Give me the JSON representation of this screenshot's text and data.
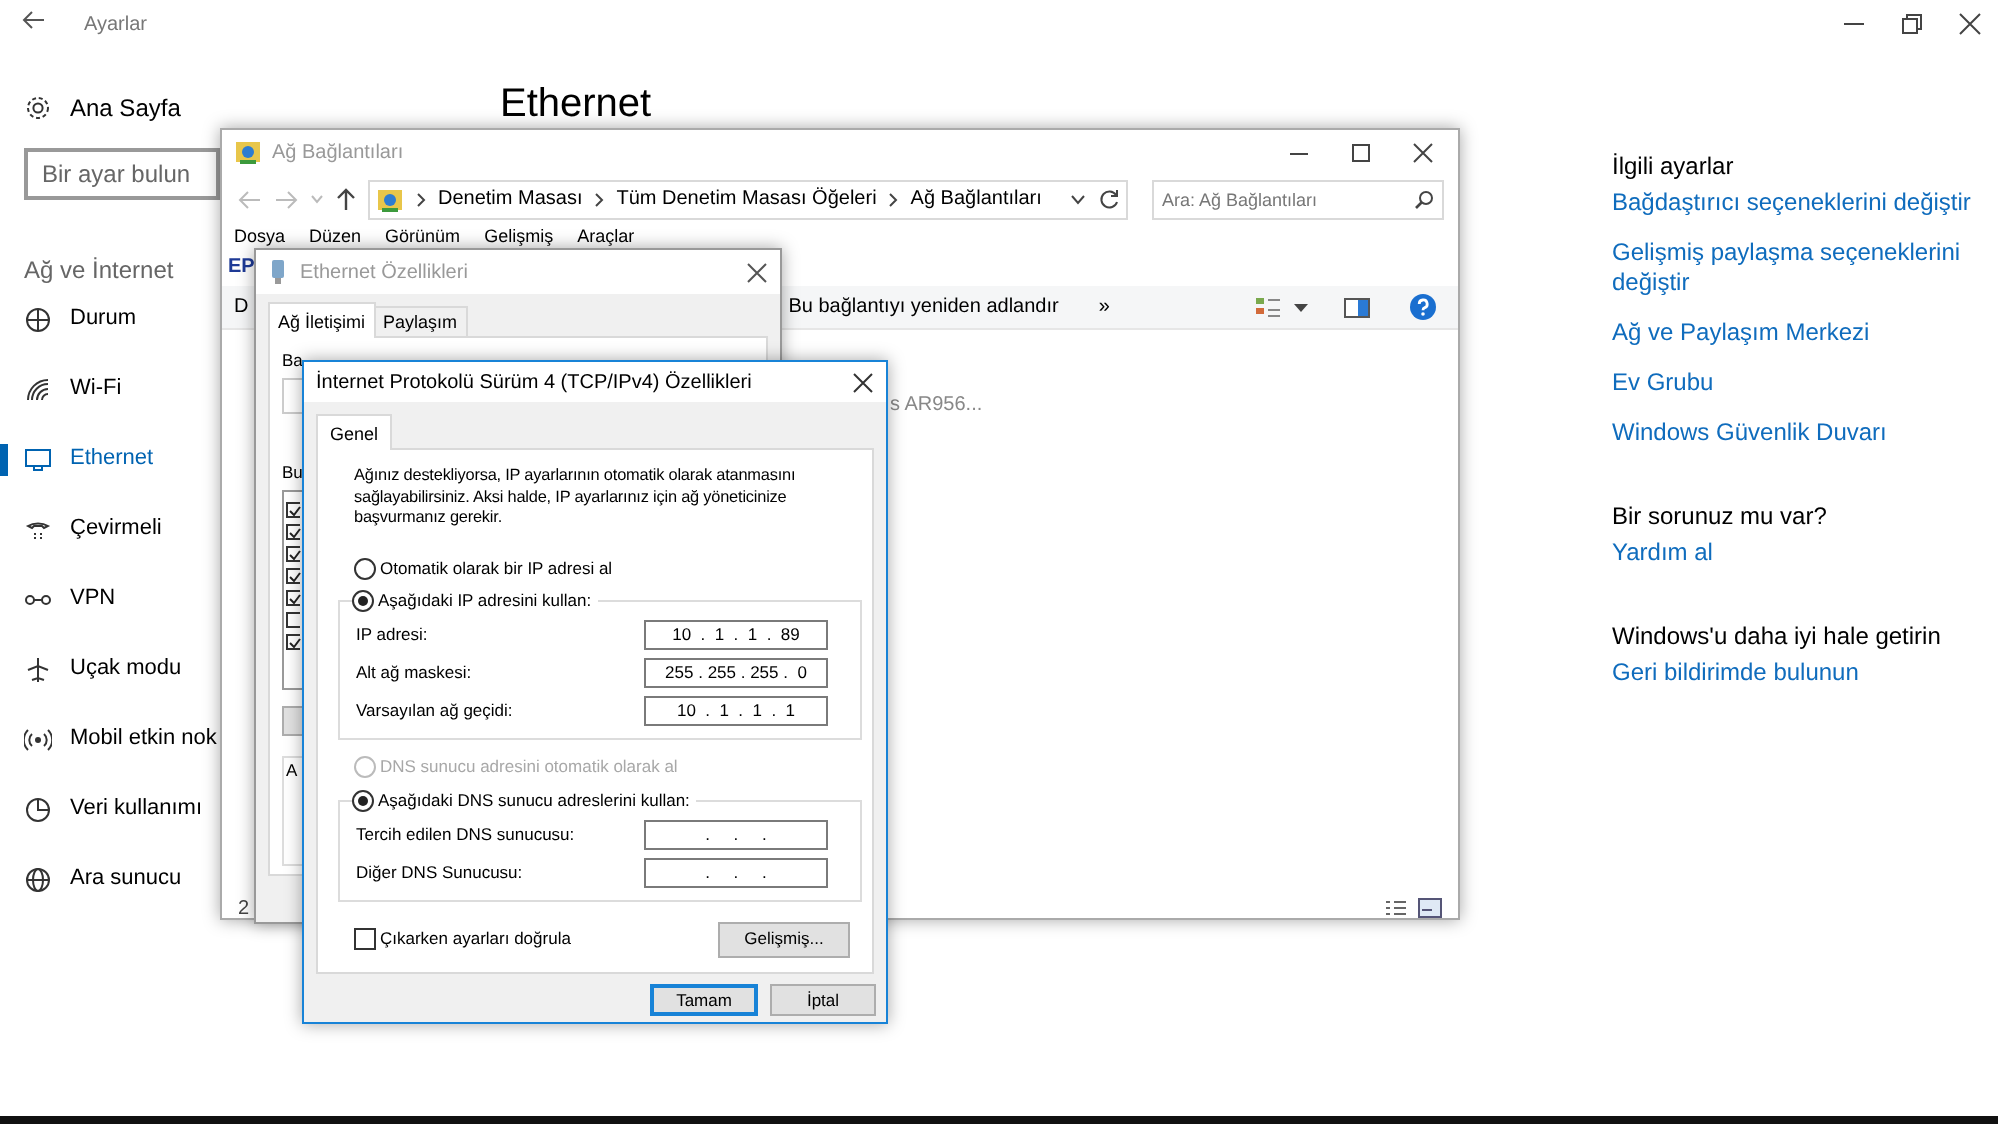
{
  "settings": {
    "title": "Ayarlar",
    "home": "Ana Sayfa",
    "search": {
      "placeholder": "Bir ayar bulun"
    },
    "section": "Ağ ve İnternet",
    "nav": [
      {
        "label": "Durum",
        "selected": false
      },
      {
        "label": "Wi-Fi",
        "selected": false
      },
      {
        "label": "Ethernet",
        "selected": true
      },
      {
        "label": "Çevirmeli",
        "selected": false
      },
      {
        "label": "VPN",
        "selected": false
      },
      {
        "label": "Uçak modu",
        "selected": false
      },
      {
        "label": "Mobil etkin nok",
        "selected": false
      },
      {
        "label": "Veri kullanımı",
        "selected": false
      },
      {
        "label": "Ara sunucu",
        "selected": false
      }
    ],
    "heading": "Ethernet",
    "related": {
      "title": "İlgili ayarlar",
      "links": [
        "Bağdaştırıcı seçeneklerini değiştir",
        "Gelişmiş paylaşma seçeneklerini değiştir",
        "Ağ ve Paylaşım Merkezi",
        "Ev Grubu",
        "Windows Güvenlik Duvarı"
      ]
    },
    "help": {
      "title": "Bir sorunuz mu var?",
      "link": "Yardım al"
    },
    "feedback": {
      "title": "Windows'u daha iyi hale getirin",
      "link": "Geri bildirimde bulunun"
    }
  },
  "explorer": {
    "title": "Ağ Bağlantıları",
    "breadcrumb": [
      "Denetim Masası",
      "Tüm Denetim Masası Öğeleri",
      "Ağ Bağlantıları"
    ],
    "search": {
      "placeholder": "Ara: Ağ Bağlantıları"
    },
    "menu": [
      "Dosya",
      "Düzen",
      "Görünüm",
      "Gelişmiş",
      "Araçlar"
    ],
    "heading_fragment": "EP",
    "command_fragment": "D",
    "command": "Bu bağlantıyı yeniden adlandır",
    "more": "»",
    "item_fragment": "s AR956...",
    "status_fragment": "2"
  },
  "ethernet_properties": {
    "title": "Ethernet Özellikleri",
    "tabs": [
      {
        "label": "Ağ İletişimi",
        "selected": true
      },
      {
        "label": "Paylaşım",
        "selected": false
      }
    ],
    "connect_fragment": "Ba",
    "list_fragment": "Bu",
    "group_fragment": "A",
    "components": [
      {
        "checked": true
      },
      {
        "checked": true
      },
      {
        "checked": true
      },
      {
        "checked": true
      },
      {
        "checked": true
      },
      {
        "checked": false
      },
      {
        "checked": true
      }
    ]
  },
  "ipv4": {
    "title": "İnternet Protokolü Sürüm 4 (TCP/IPv4) Özellikleri",
    "tab": "Genel",
    "description": "Ağınız destekliyorsa, IP ayarlarının otomatik olarak atanmasını sağlayabilirsiniz. Aksi halde, IP ayarlarınız için ağ yöneticinize başvurmanız gerekir.",
    "ip_modes": [
      {
        "label": "Otomatik olarak bir IP adresi al",
        "selected": false,
        "disabled": false
      },
      {
        "label": "Aşağıdaki IP adresini kullan:",
        "selected": true,
        "disabled": false
      }
    ],
    "ip_fields": [
      {
        "label": "IP adresi:",
        "value": "10  .  1  .  1  .  89"
      },
      {
        "label": "Alt ağ maskesi:",
        "value": "255 . 255 . 255 .  0"
      },
      {
        "label": "Varsayılan ağ geçidi:",
        "value": "10  .  1  .  1  .  1"
      }
    ],
    "dns_modes": [
      {
        "label": "DNS sunucu adresini otomatik olarak al",
        "selected": false,
        "disabled": true
      },
      {
        "label": "Aşağıdaki DNS sunucu adreslerini kullan:",
        "selected": true,
        "disabled": false
      }
    ],
    "dns_fields": [
      {
        "label": "Tercih edilen DNS sunucusu:",
        "value": ".     .     ."
      },
      {
        "label": "Diğer DNS Sunucusu:",
        "value": ".     .     ."
      }
    ],
    "validate": {
      "label": "Çıkarken ayarları doğrula",
      "checked": false
    },
    "advanced": "Gelişmiş...",
    "ok": "Tamam",
    "cancel": "İptal"
  }
}
